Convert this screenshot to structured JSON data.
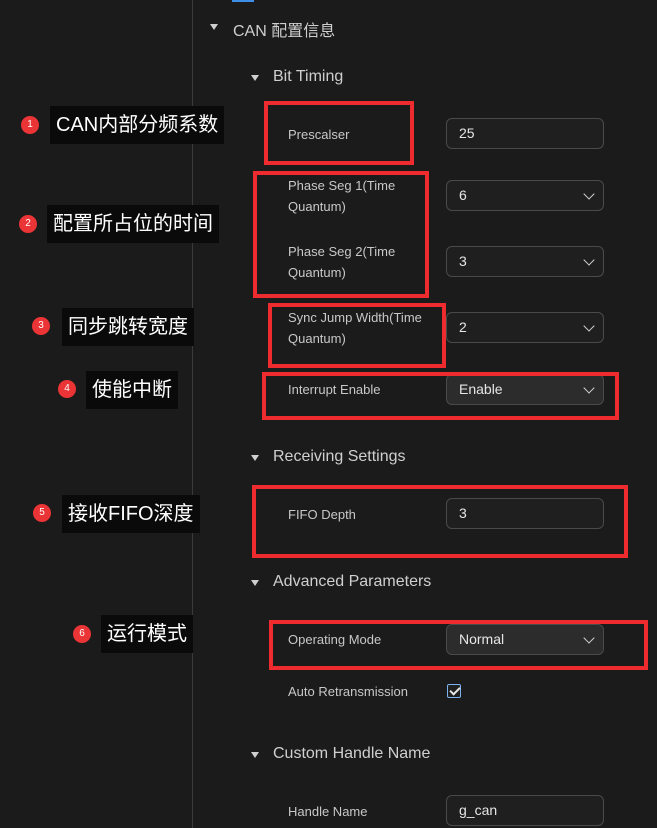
{
  "panel_title": "CAN 配置信息",
  "sections": {
    "bit_timing": {
      "title": "Bit Timing",
      "prescaler": {
        "label": "Prescalser",
        "value": "25"
      },
      "phase_seg1": {
        "label_line1": "Phase Seg 1(Time",
        "label_line2": "Quantum)",
        "value": "6"
      },
      "phase_seg2": {
        "label_line1": "Phase Seg 2(Time",
        "label_line2": "Quantum)",
        "value": "3"
      },
      "sync_jump": {
        "label_line1": "Sync Jump Width(Time",
        "label_line2": "Quantum)",
        "value": "2"
      },
      "interrupt": {
        "label": "Interrupt Enable",
        "value": "Enable"
      }
    },
    "receiving": {
      "title": "Receiving Settings",
      "fifo_depth": {
        "label": "FIFO Depth",
        "value": "3"
      }
    },
    "advanced": {
      "title": "Advanced Parameters",
      "operating_mode": {
        "label": "Operating Mode",
        "value": "Normal"
      },
      "auto_retrans": {
        "label": "Auto Retransmission",
        "checked": true
      }
    },
    "custom_handle": {
      "title": "Custom Handle Name",
      "handle_name": {
        "label": "Handle Name",
        "value": "g_can"
      }
    }
  },
  "annotations": [
    {
      "num": "1",
      "text": "CAN内部分频系数"
    },
    {
      "num": "2",
      "text": "配置所占位的时间"
    },
    {
      "num": "3",
      "text": "同步跳转宽度"
    },
    {
      "num": "4",
      "text": "使能中断"
    },
    {
      "num": "5",
      "text": "接收FIFO深度"
    },
    {
      "num": "6",
      "text": "运行模式"
    }
  ],
  "colors": {
    "highlight": "#ee2b2f",
    "badge": "#ea3435",
    "accent": "#3c8ee6",
    "background": "#1b1b1b"
  }
}
